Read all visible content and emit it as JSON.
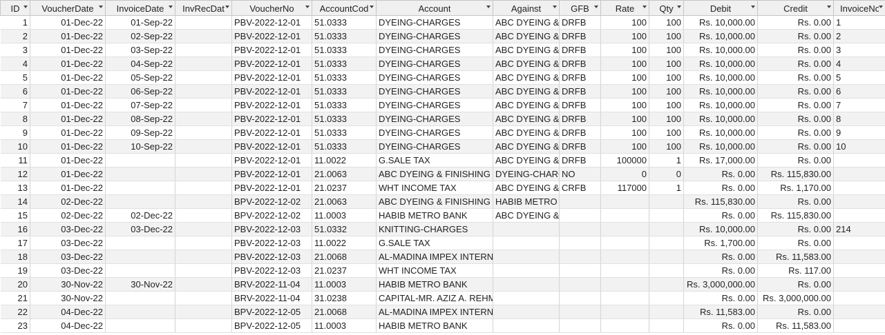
{
  "columns": [
    {
      "key": "id",
      "label": "ID",
      "align": "r"
    },
    {
      "key": "voucher_date",
      "label": "VoucherDate",
      "align": "r"
    },
    {
      "key": "invoice_date",
      "label": "InvoiceDate",
      "align": "r"
    },
    {
      "key": "inv_rec_date",
      "label": "InvRecDat",
      "align": "r"
    },
    {
      "key": "voucher_no",
      "label": "VoucherNo",
      "align": "l"
    },
    {
      "key": "account_code",
      "label": "AccountCod",
      "align": "l"
    },
    {
      "key": "account",
      "label": "Account",
      "align": "l"
    },
    {
      "key": "against",
      "label": "Against",
      "align": "l"
    },
    {
      "key": "gfb",
      "label": "GFB",
      "align": "l"
    },
    {
      "key": "rate",
      "label": "Rate",
      "align": "r"
    },
    {
      "key": "qty",
      "label": "Qty",
      "align": "r"
    },
    {
      "key": "debit",
      "label": "Debit",
      "align": "r"
    },
    {
      "key": "credit",
      "label": "Credit",
      "align": "r"
    },
    {
      "key": "invoice_no",
      "label": "InvoiceNo",
      "align": "l"
    }
  ],
  "rows": [
    {
      "id": "1",
      "voucher_date": "01-Dec-22",
      "invoice_date": "01-Sep-22",
      "inv_rec_date": "",
      "voucher_no": "PBV-2022-12-01",
      "account_code": "51.0333",
      "account": "DYEING-CHARGES",
      "against": "ABC DYEING &",
      "gfb": "DRFB",
      "rate": "100",
      "qty": "100",
      "debit": "Rs. 10,000.00",
      "credit": "Rs. 0.00",
      "invoice_no": "1"
    },
    {
      "id": "2",
      "voucher_date": "01-Dec-22",
      "invoice_date": "02-Sep-22",
      "inv_rec_date": "",
      "voucher_no": "PBV-2022-12-01",
      "account_code": "51.0333",
      "account": "DYEING-CHARGES",
      "against": "ABC DYEING &",
      "gfb": "DRFB",
      "rate": "100",
      "qty": "100",
      "debit": "Rs. 10,000.00",
      "credit": "Rs. 0.00",
      "invoice_no": "2"
    },
    {
      "id": "3",
      "voucher_date": "01-Dec-22",
      "invoice_date": "03-Sep-22",
      "inv_rec_date": "",
      "voucher_no": "PBV-2022-12-01",
      "account_code": "51.0333",
      "account": "DYEING-CHARGES",
      "against": "ABC DYEING &",
      "gfb": "DRFB",
      "rate": "100",
      "qty": "100",
      "debit": "Rs. 10,000.00",
      "credit": "Rs. 0.00",
      "invoice_no": "3"
    },
    {
      "id": "4",
      "voucher_date": "01-Dec-22",
      "invoice_date": "04-Sep-22",
      "inv_rec_date": "",
      "voucher_no": "PBV-2022-12-01",
      "account_code": "51.0333",
      "account": "DYEING-CHARGES",
      "against": "ABC DYEING &",
      "gfb": "DRFB",
      "rate": "100",
      "qty": "100",
      "debit": "Rs. 10,000.00",
      "credit": "Rs. 0.00",
      "invoice_no": "4"
    },
    {
      "id": "5",
      "voucher_date": "01-Dec-22",
      "invoice_date": "05-Sep-22",
      "inv_rec_date": "",
      "voucher_no": "PBV-2022-12-01",
      "account_code": "51.0333",
      "account": "DYEING-CHARGES",
      "against": "ABC DYEING &",
      "gfb": "DRFB",
      "rate": "100",
      "qty": "100",
      "debit": "Rs. 10,000.00",
      "credit": "Rs. 0.00",
      "invoice_no": "5"
    },
    {
      "id": "6",
      "voucher_date": "01-Dec-22",
      "invoice_date": "06-Sep-22",
      "inv_rec_date": "",
      "voucher_no": "PBV-2022-12-01",
      "account_code": "51.0333",
      "account": "DYEING-CHARGES",
      "against": "ABC DYEING &",
      "gfb": "DRFB",
      "rate": "100",
      "qty": "100",
      "debit": "Rs. 10,000.00",
      "credit": "Rs. 0.00",
      "invoice_no": "6"
    },
    {
      "id": "7",
      "voucher_date": "01-Dec-22",
      "invoice_date": "07-Sep-22",
      "inv_rec_date": "",
      "voucher_no": "PBV-2022-12-01",
      "account_code": "51.0333",
      "account": "DYEING-CHARGES",
      "against": "ABC DYEING &",
      "gfb": "DRFB",
      "rate": "100",
      "qty": "100",
      "debit": "Rs. 10,000.00",
      "credit": "Rs. 0.00",
      "invoice_no": "7"
    },
    {
      "id": "8",
      "voucher_date": "01-Dec-22",
      "invoice_date": "08-Sep-22",
      "inv_rec_date": "",
      "voucher_no": "PBV-2022-12-01",
      "account_code": "51.0333",
      "account": "DYEING-CHARGES",
      "against": "ABC DYEING &",
      "gfb": "DRFB",
      "rate": "100",
      "qty": "100",
      "debit": "Rs. 10,000.00",
      "credit": "Rs. 0.00",
      "invoice_no": "8"
    },
    {
      "id": "9",
      "voucher_date": "01-Dec-22",
      "invoice_date": "09-Sep-22",
      "inv_rec_date": "",
      "voucher_no": "PBV-2022-12-01",
      "account_code": "51.0333",
      "account": "DYEING-CHARGES",
      "against": "ABC DYEING &",
      "gfb": "DRFB",
      "rate": "100",
      "qty": "100",
      "debit": "Rs. 10,000.00",
      "credit": "Rs. 0.00",
      "invoice_no": "9"
    },
    {
      "id": "10",
      "voucher_date": "01-Dec-22",
      "invoice_date": "10-Sep-22",
      "inv_rec_date": "",
      "voucher_no": "PBV-2022-12-01",
      "account_code": "51.0333",
      "account": "DYEING-CHARGES",
      "against": "ABC DYEING &",
      "gfb": "DRFB",
      "rate": "100",
      "qty": "100",
      "debit": "Rs. 10,000.00",
      "credit": "Rs. 0.00",
      "invoice_no": "10"
    },
    {
      "id": "11",
      "voucher_date": "01-Dec-22",
      "invoice_date": "",
      "inv_rec_date": "",
      "voucher_no": "PBV-2022-12-01",
      "account_code": "11.0022",
      "account": "G.SALE TAX",
      "against": "ABC DYEING &",
      "gfb": "DRFB",
      "rate": "100000",
      "qty": "1",
      "debit": "Rs. 17,000.00",
      "credit": "Rs. 0.00",
      "invoice_no": ""
    },
    {
      "id": "12",
      "voucher_date": "01-Dec-22",
      "invoice_date": "",
      "inv_rec_date": "",
      "voucher_no": "PBV-2022-12-01",
      "account_code": "21.0063",
      "account": "ABC DYEING & FINISHING",
      "against": "DYEING-CHARG",
      "gfb": "NO",
      "rate": "0",
      "qty": "0",
      "debit": "Rs. 0.00",
      "credit": "Rs. 115,830.00",
      "invoice_no": ""
    },
    {
      "id": "13",
      "voucher_date": "01-Dec-22",
      "invoice_date": "",
      "inv_rec_date": "",
      "voucher_no": "PBV-2022-12-01",
      "account_code": "21.0237",
      "account": "WHT INCOME TAX",
      "against": "ABC DYEING &",
      "gfb": "CRFB",
      "rate": "117000",
      "qty": "1",
      "debit": "Rs. 0.00",
      "credit": "Rs. 1,170.00",
      "invoice_no": ""
    },
    {
      "id": "14",
      "voucher_date": "02-Dec-22",
      "invoice_date": "",
      "inv_rec_date": "",
      "voucher_no": "BPV-2022-12-02",
      "account_code": "21.0063",
      "account": "ABC DYEING & FINISHING",
      "against": "HABIB METRO I",
      "gfb": "",
      "rate": "",
      "qty": "",
      "debit": "Rs. 115,830.00",
      "credit": "Rs. 0.00",
      "invoice_no": ""
    },
    {
      "id": "15",
      "voucher_date": "02-Dec-22",
      "invoice_date": "02-Dec-22",
      "inv_rec_date": "",
      "voucher_no": "BPV-2022-12-02",
      "account_code": "11.0003",
      "account": "HABIB METRO BANK",
      "against": "ABC DYEING &",
      "gfb": "",
      "rate": "",
      "qty": "",
      "debit": "Rs. 0.00",
      "credit": "Rs. 115,830.00",
      "invoice_no": ""
    },
    {
      "id": "16",
      "voucher_date": "03-Dec-22",
      "invoice_date": "03-Dec-22",
      "inv_rec_date": "",
      "voucher_no": "PBV-2022-12-03",
      "account_code": "51.0332",
      "account": "KNITTING-CHARGES",
      "against": "",
      "gfb": "",
      "rate": "",
      "qty": "",
      "debit": "Rs. 10,000.00",
      "credit": "Rs. 0.00",
      "invoice_no": "214"
    },
    {
      "id": "17",
      "voucher_date": "03-Dec-22",
      "invoice_date": "",
      "inv_rec_date": "",
      "voucher_no": "PBV-2022-12-03",
      "account_code": "11.0022",
      "account": "G.SALE TAX",
      "against": "",
      "gfb": "",
      "rate": "",
      "qty": "",
      "debit": "Rs. 1,700.00",
      "credit": "Rs. 0.00",
      "invoice_no": ""
    },
    {
      "id": "18",
      "voucher_date": "03-Dec-22",
      "invoice_date": "",
      "inv_rec_date": "",
      "voucher_no": "PBV-2022-12-03",
      "account_code": "21.0068",
      "account": "AL-MADINA IMPEX INTERN",
      "against": "",
      "gfb": "",
      "rate": "",
      "qty": "",
      "debit": "Rs. 0.00",
      "credit": "Rs. 11,583.00",
      "invoice_no": ""
    },
    {
      "id": "19",
      "voucher_date": "03-Dec-22",
      "invoice_date": "",
      "inv_rec_date": "",
      "voucher_no": "PBV-2022-12-03",
      "account_code": "21.0237",
      "account": "WHT INCOME TAX",
      "against": "",
      "gfb": "",
      "rate": "",
      "qty": "",
      "debit": "Rs. 0.00",
      "credit": "Rs. 117.00",
      "invoice_no": ""
    },
    {
      "id": "20",
      "voucher_date": "30-Nov-22",
      "invoice_date": "30-Nov-22",
      "inv_rec_date": "",
      "voucher_no": "BRV-2022-11-04",
      "account_code": "11.0003",
      "account": "HABIB METRO BANK",
      "against": "",
      "gfb": "",
      "rate": "",
      "qty": "",
      "debit": "Rs. 3,000,000.00",
      "credit": "Rs. 0.00",
      "invoice_no": ""
    },
    {
      "id": "21",
      "voucher_date": "30-Nov-22",
      "invoice_date": "",
      "inv_rec_date": "",
      "voucher_no": "BRV-2022-11-04",
      "account_code": "31.0238",
      "account": "CAPITAL-MR. AZIZ A. REHM",
      "against": "",
      "gfb": "",
      "rate": "",
      "qty": "",
      "debit": "Rs. 0.00",
      "credit": "Rs. 3,000,000.00",
      "invoice_no": ""
    },
    {
      "id": "22",
      "voucher_date": "04-Dec-22",
      "invoice_date": "",
      "inv_rec_date": "",
      "voucher_no": "BPV-2022-12-05",
      "account_code": "21.0068",
      "account": "AL-MADINA IMPEX INTERN",
      "against": "",
      "gfb": "",
      "rate": "",
      "qty": "",
      "debit": "Rs. 11,583.00",
      "credit": "Rs. 0.00",
      "invoice_no": ""
    },
    {
      "id": "23",
      "voucher_date": "04-Dec-22",
      "invoice_date": "",
      "inv_rec_date": "",
      "voucher_no": "BPV-2022-12-05",
      "account_code": "11.0003",
      "account": "HABIB METRO BANK",
      "against": "",
      "gfb": "",
      "rate": "",
      "qty": "",
      "debit": "Rs. 0.00",
      "credit": "Rs. 11,583.00",
      "invoice_no": ""
    }
  ]
}
